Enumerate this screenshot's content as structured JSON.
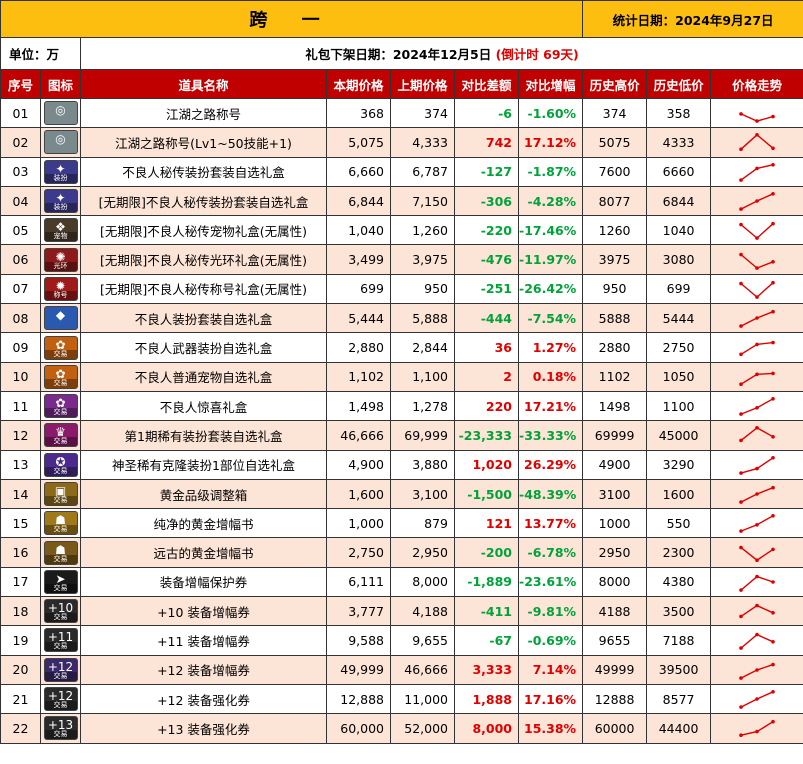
{
  "header": {
    "title": "跨 一",
    "stat_date": "统计日期：2024年9月27日",
    "unit": "单位：万",
    "removal_date": "礼包下架日期：2024年12月5日",
    "countdown": "(倒计时 69天)"
  },
  "columns": [
    "序号",
    "图标",
    "道具名称",
    "本期价格",
    "上期价格",
    "对比差额",
    "对比增幅",
    "历史高价",
    "历史低价",
    "价格走势"
  ],
  "colors": {
    "title_bg": "#fdbe10",
    "header_bg": "#c00000",
    "row_alt_bg": "#fce4d6",
    "up": "#e00000",
    "down": "#00a33a"
  },
  "rows": [
    {
      "no": "01",
      "icon": "jianghu-title-icon",
      "icon_color": "#7a8a8c",
      "glyph": "◎",
      "tag": "",
      "name": "江湖之路称号",
      "cur": "368",
      "prev": "374",
      "diff": "-6",
      "pct": "-1.60%",
      "high": "374",
      "low": "358",
      "trend": [
        0.55,
        0.95,
        0.7
      ]
    },
    {
      "no": "02",
      "icon": "jianghu-title-plus-icon",
      "icon_color": "#7a8a8c",
      "glyph": "◎",
      "tag": "",
      "name": "江湖之路称号(Lv1~50技能+1)",
      "cur": "5,075",
      "prev": "4,333",
      "diff": "742",
      "pct": "17.12%",
      "high": "5075",
      "low": "4333",
      "trend": [
        0.9,
        0.1,
        0.85
      ]
    },
    {
      "no": "03",
      "icon": "delinquent-costume-icon",
      "icon_color": "#3c3a8c",
      "glyph": "✦",
      "tag": "装扮",
      "name": "不良人秘传装扮套装自选礼盒",
      "cur": "6,660",
      "prev": "6,787",
      "diff": "-127",
      "pct": "-1.87%",
      "high": "7600",
      "low": "6660",
      "trend": [
        0.95,
        0.3,
        0.1
      ]
    },
    {
      "no": "04",
      "icon": "delinquent-costume-limited-icon",
      "icon_color": "#3c3a8c",
      "glyph": "✦",
      "tag": "装扮",
      "name": "[无期限]不良人秘传装扮套装自选礼盒",
      "cur": "6,844",
      "prev": "7,150",
      "diff": "-306",
      "pct": "-4.28%",
      "high": "8077",
      "low": "6844",
      "trend": [
        0.95,
        0.5,
        0.1
      ]
    },
    {
      "no": "05",
      "icon": "delinquent-pet-icon",
      "icon_color": "#4a3a2a",
      "glyph": "❖",
      "tag": "宠物",
      "name": "[无期限]不良人秘传宠物礼盒(无属性)",
      "cur": "1,040",
      "prev": "1,260",
      "diff": "-220",
      "pct": "-17.46%",
      "high": "1260",
      "low": "1040",
      "trend": [
        0.2,
        0.95,
        0.15
      ]
    },
    {
      "no": "06",
      "icon": "delinquent-aura-icon",
      "icon_color": "#8c1a1a",
      "glyph": "✺",
      "tag": "光环",
      "name": "[无期限]不良人秘传光环礼盒(无属性)",
      "cur": "3,499",
      "prev": "3,975",
      "diff": "-476",
      "pct": "-11.97%",
      "high": "3975",
      "low": "3080",
      "trend": [
        0.2,
        0.95,
        0.6
      ]
    },
    {
      "no": "07",
      "icon": "delinquent-title-icon",
      "icon_color": "#a01a1a",
      "glyph": "✹",
      "tag": "称号",
      "name": "[无期限]不良人秘传称号礼盒(无属性)",
      "cur": "699",
      "prev": "950",
      "diff": "-251",
      "pct": "-26.42%",
      "high": "950",
      "low": "699",
      "trend": [
        0.2,
        0.95,
        0.15
      ]
    },
    {
      "no": "08",
      "icon": "delinquent-costume-box-icon",
      "icon_color": "#2a5ab0",
      "glyph": "◆",
      "tag": "",
      "name": "不良人装扮套装自选礼盒",
      "cur": "5,444",
      "prev": "5,888",
      "diff": "-444",
      "pct": "-7.54%",
      "high": "5888",
      "low": "5444",
      "trend": [
        0.95,
        0.5,
        0.15
      ]
    },
    {
      "no": "09",
      "icon": "delinquent-weapon-costume-icon",
      "icon_color": "#c06010",
      "glyph": "✿",
      "tag": "交易",
      "name": "不良人武器装扮自选礼盒",
      "cur": "2,880",
      "prev": "2,844",
      "diff": "36",
      "pct": "1.27%",
      "high": "2880",
      "low": "2750",
      "trend": [
        0.85,
        0.3,
        0.2
      ]
    },
    {
      "no": "10",
      "icon": "delinquent-normal-pet-icon",
      "icon_color": "#c06010",
      "glyph": "✿",
      "tag": "交易",
      "name": "不良人普通宠物自选礼盒",
      "cur": "1,102",
      "prev": "1,100",
      "diff": "2",
      "pct": "0.18%",
      "high": "1102",
      "low": "1050",
      "trend": [
        0.9,
        0.35,
        0.3
      ]
    },
    {
      "no": "11",
      "icon": "delinquent-surprise-box-icon",
      "icon_color": "#7a2a8c",
      "glyph": "✿",
      "tag": "交易",
      "name": "不良人惊喜礼盒",
      "cur": "1,498",
      "prev": "1,278",
      "diff": "220",
      "pct": "17.21%",
      "high": "1498",
      "low": "1100",
      "trend": [
        0.95,
        0.6,
        0.1
      ]
    },
    {
      "no": "12",
      "icon": "rare-costume-box-icon",
      "icon_color": "#8c1a6a",
      "glyph": "♛",
      "tag": "交易",
      "name": "第1期稀有装扮套装自选礼盒",
      "cur": "46,666",
      "prev": "69,999",
      "diff": "-23,333",
      "pct": "-33.33%",
      "high": "69999",
      "low": "45000",
      "trend": [
        0.8,
        0.1,
        0.6
      ]
    },
    {
      "no": "13",
      "icon": "divine-rare-clone-costume-icon",
      "icon_color": "#4a2a8c",
      "glyph": "✪",
      "tag": "交易",
      "name": "神圣稀有克隆装扮1部位自选礼盒",
      "cur": "4,900",
      "prev": "3,880",
      "diff": "1,020",
      "pct": "26.29%",
      "high": "4900",
      "low": "3290",
      "trend": [
        0.95,
        0.7,
        0.1
      ]
    },
    {
      "no": "14",
      "icon": "gold-grade-box-icon",
      "icon_color": "#8c6a1a",
      "glyph": "▣",
      "tag": "交易",
      "name": "黄金品级调整箱",
      "cur": "1,600",
      "prev": "3,100",
      "diff": "-1,500",
      "pct": "-48.39%",
      "high": "3100",
      "low": "1600",
      "trend": [
        0.95,
        0.5,
        0.15
      ]
    },
    {
      "no": "15",
      "icon": "pure-gold-amplify-icon",
      "icon_color": "#a07a1a",
      "glyph": "☗",
      "tag": "交易",
      "name": "纯净的黄金增幅书",
      "cur": "1,000",
      "prev": "879",
      "diff": "121",
      "pct": "13.77%",
      "high": "1000",
      "low": "550",
      "trend": [
        0.95,
        0.6,
        0.1
      ]
    },
    {
      "no": "16",
      "icon": "ancient-gold-amplify-icon",
      "icon_color": "#7a5a1a",
      "glyph": "☗",
      "tag": "交易",
      "name": "远古的黄金增幅书",
      "cur": "2,750",
      "prev": "2,950",
      "diff": "-200",
      "pct": "-6.78%",
      "high": "2950",
      "low": "2300",
      "trend": [
        0.2,
        0.9,
        0.3
      ]
    },
    {
      "no": "17",
      "icon": "equip-protect-icon",
      "icon_color": "#1a1a1a",
      "glyph": "➤",
      "tag": "交易",
      "name": "装备增幅保护券",
      "cur": "6,111",
      "prev": "8,000",
      "diff": "-1,889",
      "pct": "-23.61%",
      "high": "8000",
      "low": "4380",
      "trend": [
        0.95,
        0.2,
        0.5
      ]
    },
    {
      "no": "18",
      "icon": "plus10-amplify-icon",
      "icon_color": "#2a2a2a",
      "glyph": "+10",
      "tag": "交易",
      "name": "+10 装备增幅券",
      "cur": "3,777",
      "prev": "4,188",
      "diff": "-411",
      "pct": "-9.81%",
      "high": "4188",
      "low": "3500",
      "trend": [
        0.8,
        0.2,
        0.6
      ]
    },
    {
      "no": "19",
      "icon": "plus11-amplify-icon",
      "icon_color": "#2a2a2a",
      "glyph": "+11",
      "tag": "交易",
      "name": "+11 装备增幅券",
      "cur": "9,588",
      "prev": "9,655",
      "diff": "-67",
      "pct": "-0.69%",
      "high": "9655",
      "low": "7188",
      "trend": [
        0.95,
        0.2,
        0.6
      ]
    },
    {
      "no": "20",
      "icon": "plus12-amplify-icon",
      "icon_color": "#3a2a6a",
      "glyph": "+12",
      "tag": "交易",
      "name": "+12 装备增幅券",
      "cur": "49,999",
      "prev": "46,666",
      "diff": "3,333",
      "pct": "7.14%",
      "high": "49999",
      "low": "39500",
      "trend": [
        0.95,
        0.5,
        0.2
      ]
    },
    {
      "no": "21",
      "icon": "plus12-reinforce-icon",
      "icon_color": "#2a2a2a",
      "glyph": "+12",
      "tag": "交易",
      "name": "+12 装备强化券",
      "cur": "12,888",
      "prev": "11,000",
      "diff": "1,888",
      "pct": "17.16%",
      "high": "12888",
      "low": "8577",
      "trend": [
        0.95,
        0.5,
        0.1
      ]
    },
    {
      "no": "22",
      "icon": "plus13-reinforce-icon",
      "icon_color": "#2a2a2a",
      "glyph": "+13",
      "tag": "交易",
      "name": "+13 装备强化券",
      "cur": "60,000",
      "prev": "52,000",
      "diff": "8,000",
      "pct": "15.38%",
      "high": "60000",
      "low": "44400",
      "trend": [
        0.9,
        0.7,
        0.15
      ]
    }
  ]
}
